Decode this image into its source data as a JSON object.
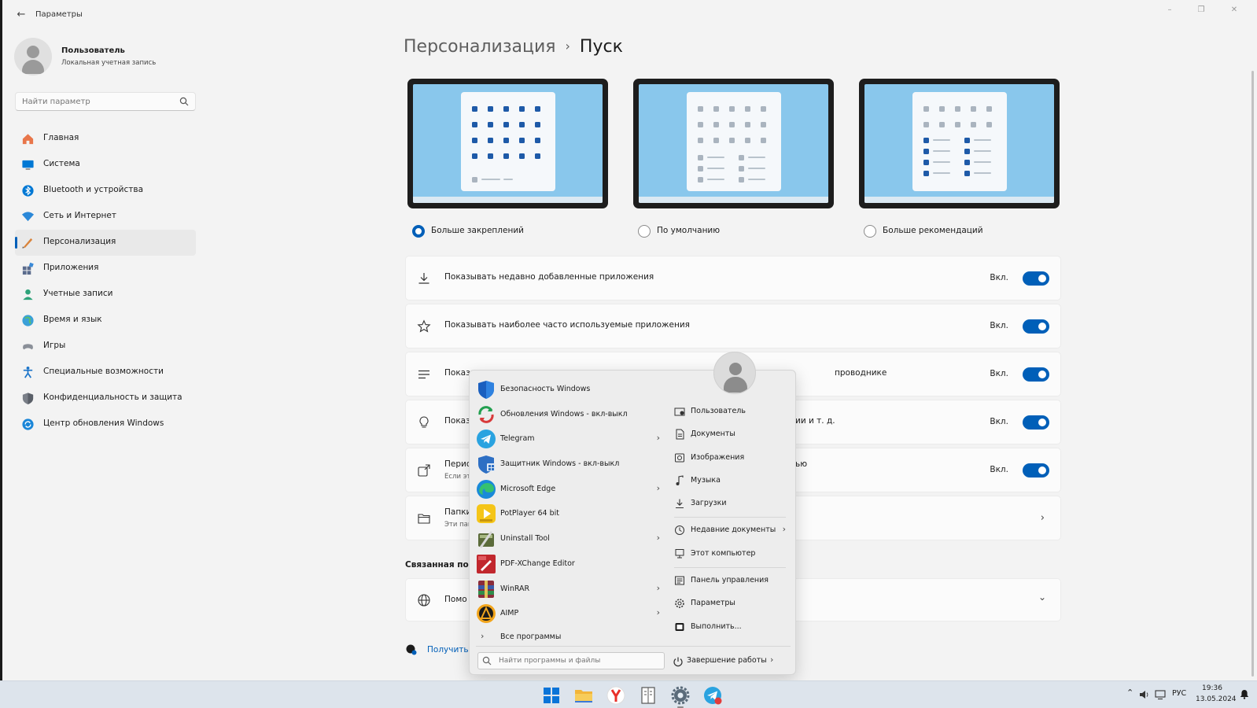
{
  "window": {
    "title": "Параметры",
    "back_glyph": "←",
    "controls": [
      "–",
      "❐",
      "✕"
    ]
  },
  "user": {
    "name": "Пользователь",
    "account_type": "Локальная учетная запись"
  },
  "search": {
    "placeholder": "Найти параметр"
  },
  "sidebar": {
    "items": [
      {
        "label": "Главная",
        "icon": "home-icon",
        "color": "#e8764a"
      },
      {
        "label": "Система",
        "icon": "system-icon",
        "color": "#0078d4"
      },
      {
        "label": "Bluetooth и устройства",
        "icon": "bluetooth-icon",
        "color": "#0078d4"
      },
      {
        "label": "Сеть и Интернет",
        "icon": "network-icon",
        "color": "#2b88d8"
      },
      {
        "label": "Персонализация",
        "icon": "personalization-icon",
        "color": "#d9843b",
        "active": true
      },
      {
        "label": "Приложения",
        "icon": "apps-icon",
        "color": "#5a6b8c"
      },
      {
        "label": "Учетные записи",
        "icon": "accounts-icon",
        "color": "#2fa37a"
      },
      {
        "label": "Время и язык",
        "icon": "time-language-icon",
        "color": "#3aa0d8"
      },
      {
        "label": "Игры",
        "icon": "gaming-icon",
        "color": "#8a8f98"
      },
      {
        "label": "Специальные возможности",
        "icon": "accessibility-icon",
        "color": "#1a73c8"
      },
      {
        "label": "Конфиденциальность и защита",
        "icon": "privacy-shield-icon",
        "color": "#7a7f88"
      },
      {
        "label": "Центр обновления Windows",
        "icon": "windows-update-icon",
        "color": "#1a86d8"
      }
    ]
  },
  "breadcrumb": {
    "parent": "Персонализация",
    "separator": "›",
    "current": "Пуск"
  },
  "layouts": [
    {
      "label": "Больше закреплений",
      "selected": true
    },
    {
      "label": "По умолчанию",
      "selected": false
    },
    {
      "label": "Больше рекомендаций",
      "selected": false
    }
  ],
  "settings": {
    "state_on": "Вкл.",
    "rows": [
      {
        "label": "Показывать недавно добавленные приложения",
        "icon": "download-icon",
        "state": "Вкл."
      },
      {
        "label": "Показывать наиболее часто используемые приложения",
        "icon": "star-icon",
        "state": "Вкл."
      },
      {
        "label": "Показ",
        "tail": "проводнике",
        "icon": "list-icon",
        "state": "Вкл."
      },
      {
        "label": "Показ",
        "tail": "ии и т. д.",
        "icon": "lightbulb-icon",
        "state": "Вкл."
      },
      {
        "label": "Перио",
        "sub": "Если эт",
        "tail": "ью",
        "icon": "share-icon",
        "state": "Вкл."
      },
      {
        "label": "Папки",
        "sub": "Эти пап",
        "icon": "folder-icon"
      }
    ]
  },
  "related": {
    "heading": "Связанная под",
    "help_label": "Помо",
    "get_help": "Получить"
  },
  "start_menu": {
    "apps": [
      {
        "label": "Безопасность Windows",
        "icon": "windows-security-icon",
        "chevron": false
      },
      {
        "label": "Обновления Windows - вкл-выкл",
        "icon": "windows-updates-toggle-icon",
        "chevron": false
      },
      {
        "label": "Telegram",
        "icon": "telegram-icon",
        "chevron": true
      },
      {
        "label": "Защитник Windows - вкл-выкл",
        "icon": "windows-defender-icon",
        "chevron": false
      },
      {
        "label": "Microsoft Edge",
        "icon": "edge-icon",
        "chevron": true
      },
      {
        "label": "PotPlayer 64 bit",
        "icon": "potplayer-icon",
        "chevron": false
      },
      {
        "label": "Uninstall Tool",
        "icon": "uninstall-tool-icon",
        "chevron": true
      },
      {
        "label": "PDF-XChange Editor",
        "icon": "pdf-xchange-icon",
        "chevron": false
      },
      {
        "label": "WinRAR",
        "icon": "winrar-icon",
        "chevron": true
      },
      {
        "label": "AIMP",
        "icon": "aimp-icon",
        "chevron": true
      }
    ],
    "all_programs": "Все программы",
    "search_placeholder": "Найти программы и файлы",
    "places": [
      {
        "label": "Пользователь",
        "icon": "user-folder-icon"
      },
      {
        "label": "Документы",
        "icon": "documents-icon"
      },
      {
        "label": "Изображения",
        "icon": "pictures-icon"
      },
      {
        "label": "Музыка",
        "icon": "music-icon"
      },
      {
        "label": "Загрузки",
        "icon": "downloads-icon"
      },
      {
        "label": "Недавние документы",
        "icon": "recent-icon",
        "chevron": true
      },
      {
        "label": "Этот компьютер",
        "icon": "this-pc-icon"
      },
      {
        "label": "Панель управления",
        "icon": "control-panel-icon"
      },
      {
        "label": "Параметры",
        "icon": "settings-gear-icon"
      },
      {
        "label": "Выполнить...",
        "icon": "run-icon"
      }
    ],
    "shutdown": "Завершение работы"
  },
  "taskbar": {
    "apps": [
      "windows-start-icon",
      "file-explorer-icon",
      "yandex-browser-icon",
      "notes-app-icon",
      "settings-app-icon",
      "telegram-taskbar-icon"
    ],
    "tray": {
      "language": "РУС",
      "time": "19:36",
      "date": "13.05.2024"
    }
  },
  "colors": {
    "accent": "#005fb8",
    "wallpaper": "#89c7ec",
    "dot_dark": "#1e5aa8",
    "dot_light": "#aab4bf"
  }
}
